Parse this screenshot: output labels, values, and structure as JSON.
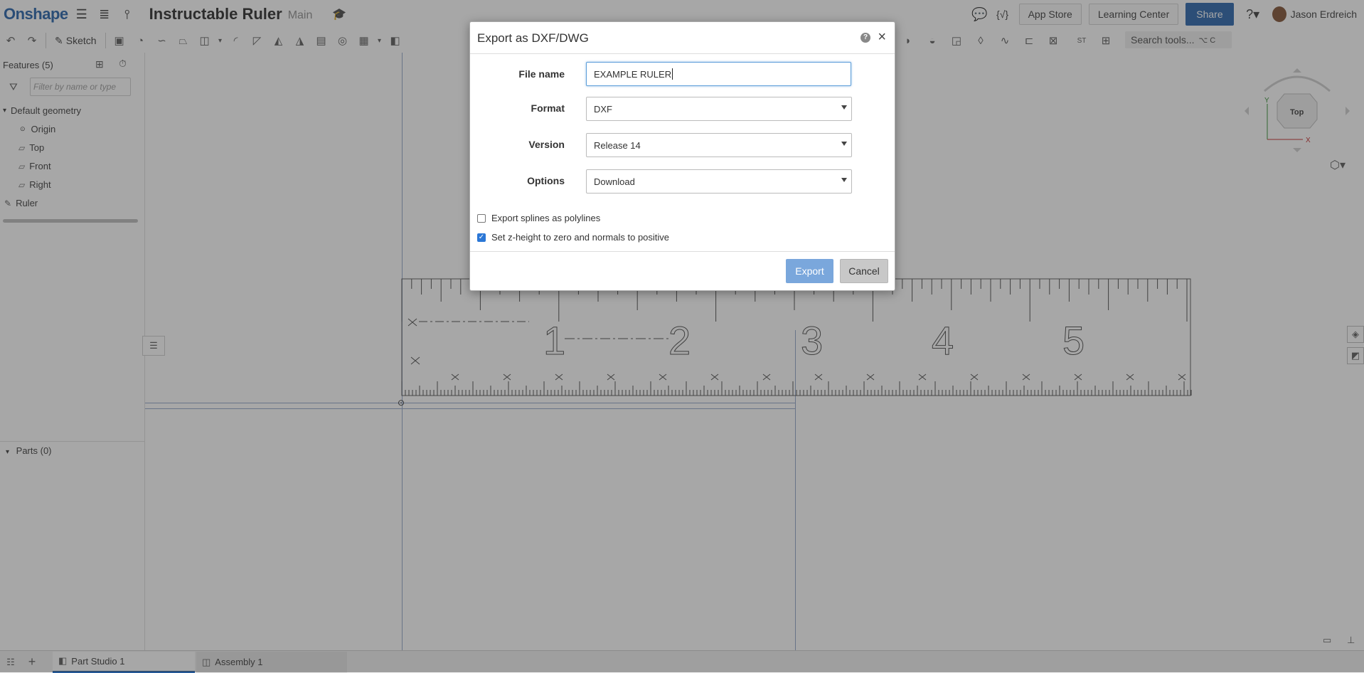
{
  "app": {
    "logo": "Onshape",
    "document_title": "Instructable Ruler",
    "branch": "Main"
  },
  "topbar": {
    "app_store": "App Store",
    "learning_center": "Learning Center",
    "share": "Share",
    "user_name": "Jason Erdreich"
  },
  "toolbar": {
    "sketch_label": "Sketch",
    "search_label": "Search tools...",
    "search_shortcut": "⌥ C"
  },
  "panel": {
    "features_title": "Features (5)",
    "filter_placeholder": "Filter by name or type",
    "tree": {
      "default_geometry": "Default geometry",
      "origin": "Origin",
      "top": "Top",
      "front": "Front",
      "right": "Right",
      "ruler": "Ruler"
    },
    "parts_title": "Parts (0)"
  },
  "viewcube": {
    "face": "Top",
    "axis_y": "Y",
    "axis_x": "X"
  },
  "ruler": {
    "numbers": [
      "1",
      "2",
      "3",
      "4",
      "5"
    ]
  },
  "tabs": {
    "part_studio": "Part Studio 1",
    "assembly": "Assembly 1"
  },
  "dialog": {
    "title": "Export as DXF/DWG",
    "file_name_label": "File name",
    "file_name_value": "EXAMPLE RULER",
    "format_label": "Format",
    "format_value": "DXF",
    "version_label": "Version",
    "version_value": "Release 14",
    "options_label": "Options",
    "options_value": "Download",
    "export_splines_label": "Export splines as polylines",
    "export_splines_checked": false,
    "z_height_label": "Set z-height to zero and normals to positive",
    "z_height_checked": true,
    "export_button": "Export",
    "cancel_button": "Cancel"
  },
  "colors": {
    "brand": "#1d5ca6",
    "primary_button": "#1f5ea8",
    "export_button_disabled": "#7aa7dc",
    "checkbox_checked": "#2b77d6"
  }
}
